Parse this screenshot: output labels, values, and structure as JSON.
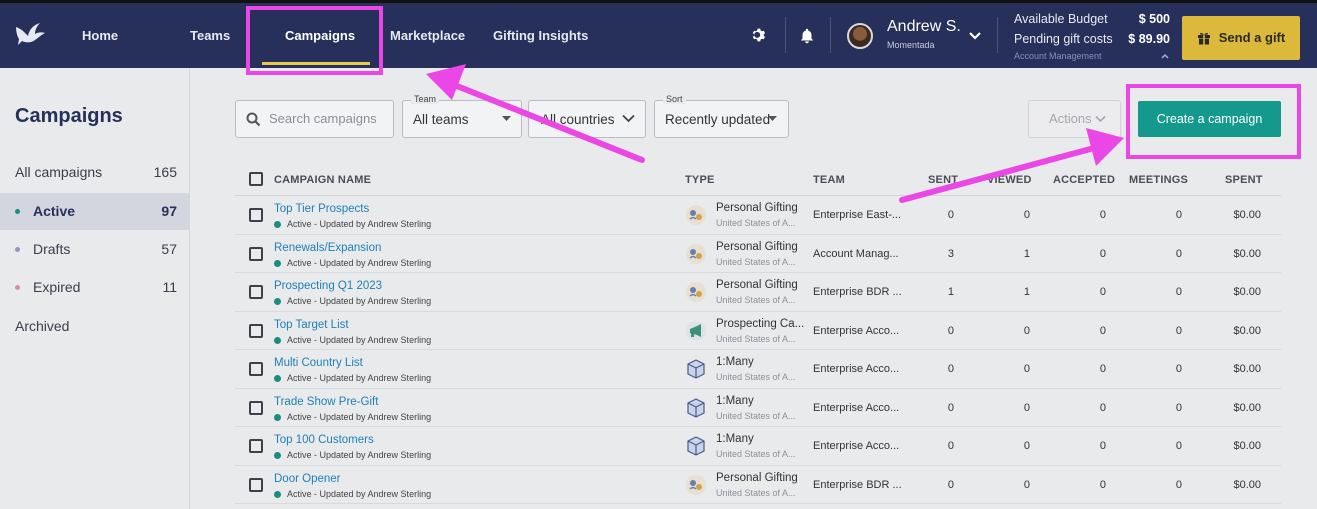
{
  "nav": {
    "items": [
      {
        "label": "Home"
      },
      {
        "label": "Teams"
      },
      {
        "label": "Campaigns"
      },
      {
        "label": "Marketplace"
      },
      {
        "label": "Gifting Insights"
      }
    ],
    "active": "Campaigns",
    "user": {
      "name": "Andrew S.",
      "org": "Momentada"
    },
    "budget": {
      "available_label": "Available Budget",
      "available_value": "$ 500",
      "pending_label": "Pending gift costs",
      "pending_value": "$ 89.90",
      "account_link": "Account Management"
    },
    "send_gift_label": "Send a gift",
    "accent_color": "#e7c84b",
    "highlight_color": "#ea47e6"
  },
  "sidebar": {
    "title": "Campaigns",
    "items": [
      {
        "label": "All campaigns",
        "count": "165"
      },
      {
        "label": "Active",
        "count": "97",
        "dot": "#1a8c80"
      },
      {
        "label": "Drafts",
        "count": "57",
        "dot": "#9a8fc7"
      },
      {
        "label": "Expired",
        "count": "11",
        "dot": "#e08b9a"
      },
      {
        "label": "Archived",
        "count": ""
      }
    ]
  },
  "toolbar": {
    "search_placeholder": "Search campaigns",
    "team_label": "Team",
    "team_value": "All teams",
    "country_value": "All countries",
    "sort_label": "Sort",
    "sort_value": "Recently updated",
    "actions_label": "Actions",
    "create_label": "Create a campaign"
  },
  "table": {
    "headers": {
      "name": "CAMPAIGN NAME",
      "type": "TYPE",
      "team": "TEAM",
      "sent": "SENT",
      "viewed": "VIEWED",
      "accepted": "ACCEPTED",
      "meetings": "MEETINGS",
      "spent": "SPENT"
    },
    "rows": [
      {
        "name": "Top Tier Prospects",
        "status": "Active - Updated by Andrew Sterling",
        "type": "Personal Gifting",
        "type_sub": "United States of A...",
        "icon": "personal-gifting-icon",
        "team": "Enterprise East-...",
        "sent": "0",
        "viewed": "0",
        "accepted": "0",
        "meetings": "0",
        "spent": "$0.00"
      },
      {
        "name": "Renewals/Expansion",
        "status": "Active - Updated by Andrew Sterling",
        "type": "Personal Gifting",
        "type_sub": "United States of A...",
        "icon": "personal-gifting-icon",
        "team": "Account Manag...",
        "sent": "3",
        "viewed": "1",
        "accepted": "0",
        "meetings": "0",
        "spent": "$0.00"
      },
      {
        "name": "Prospecting Q1 2023",
        "status": "Active - Updated by Andrew Sterling",
        "type": "Personal Gifting",
        "type_sub": "United States of A...",
        "icon": "personal-gifting-icon",
        "team": "Enterprise BDR ...",
        "sent": "1",
        "viewed": "1",
        "accepted": "0",
        "meetings": "0",
        "spent": "$0.00"
      },
      {
        "name": "Top Target List",
        "status": "Active - Updated by Andrew Sterling",
        "type": "Prospecting Ca...",
        "type_sub": "United States of A...",
        "icon": "megaphone-icon",
        "team": "Enterprise Acco...",
        "sent": "0",
        "viewed": "0",
        "accepted": "0",
        "meetings": "0",
        "spent": "$0.00"
      },
      {
        "name": "Multi Country List",
        "status": "Active - Updated by Andrew Sterling",
        "type": "1:Many",
        "type_sub": "United States of A...",
        "icon": "boxes-icon",
        "team": "Enterprise Acco...",
        "sent": "0",
        "viewed": "0",
        "accepted": "0",
        "meetings": "0",
        "spent": "$0.00"
      },
      {
        "name": "Trade Show Pre-Gift",
        "status": "Active - Updated by Andrew Sterling",
        "type": "1:Many",
        "type_sub": "United States of A...",
        "icon": "boxes-icon",
        "team": "Enterprise Acco...",
        "sent": "0",
        "viewed": "0",
        "accepted": "0",
        "meetings": "0",
        "spent": "$0.00"
      },
      {
        "name": "Top 100 Customers",
        "status": "Active - Updated by Andrew Sterling",
        "type": "1:Many",
        "type_sub": "United States of A...",
        "icon": "boxes-icon",
        "team": "Enterprise Acco...",
        "sent": "0",
        "viewed": "0",
        "accepted": "0",
        "meetings": "0",
        "spent": "$0.00"
      },
      {
        "name": "Door Opener",
        "status": "Active - Updated by Andrew Sterling",
        "type": "Personal Gifting",
        "type_sub": "United States of A...",
        "icon": "personal-gifting-icon",
        "team": "Enterprise BDR ...",
        "sent": "0",
        "viewed": "0",
        "accepted": "0",
        "meetings": "0",
        "spent": "$0.00"
      }
    ]
  }
}
